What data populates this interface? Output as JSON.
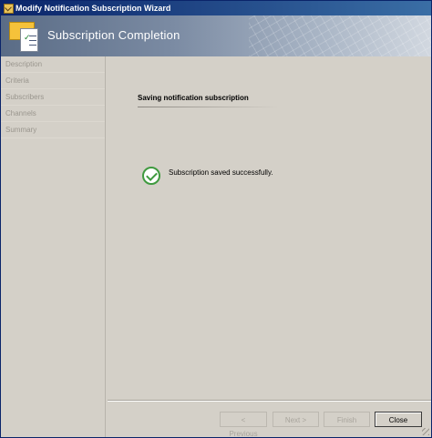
{
  "window": {
    "title": "Modify Notification Subscription Wizard"
  },
  "banner": {
    "title": "Subscription Completion",
    "icon": "envelope-document-icon"
  },
  "nav": {
    "items": [
      {
        "label": "Description"
      },
      {
        "label": "Criteria"
      },
      {
        "label": "Subscribers"
      },
      {
        "label": "Channels"
      },
      {
        "label": "Summary"
      }
    ]
  },
  "main": {
    "section_title": "Saving notification subscription",
    "status_icon": "success-check-icon",
    "status_text": "Subscription saved successfully."
  },
  "buttons": {
    "previous": "< Previous",
    "next": "Next >",
    "finish": "Finish",
    "close": "Close"
  }
}
